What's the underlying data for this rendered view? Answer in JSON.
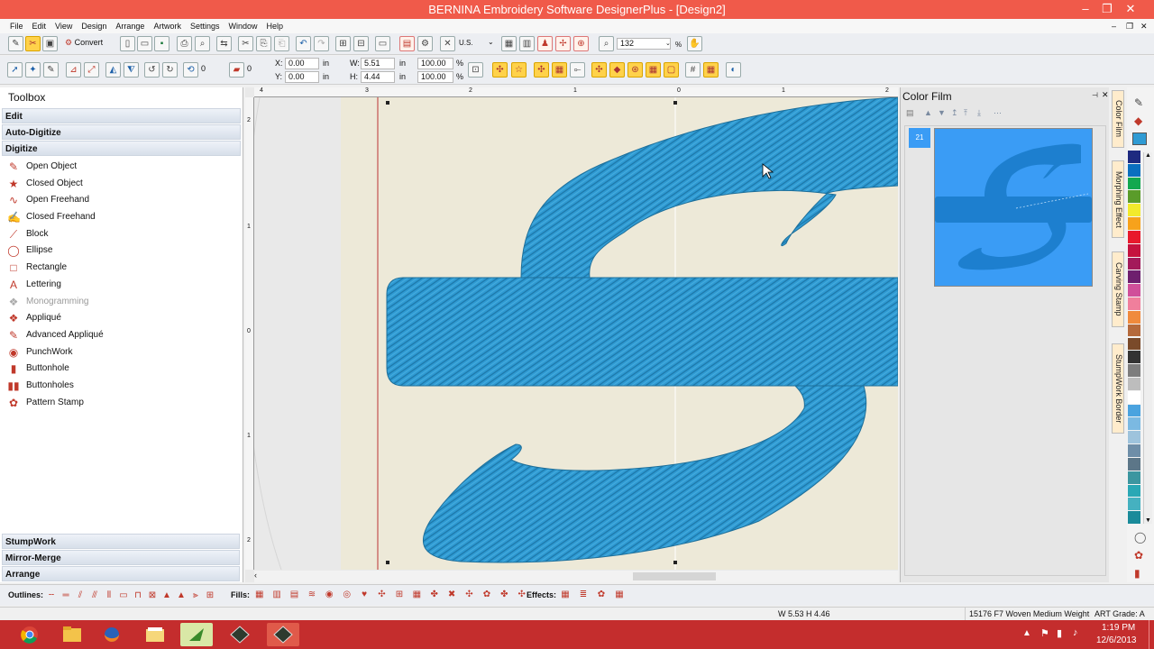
{
  "window": {
    "title": "BERNINA Embroidery Software DesignerPlus - [Design2]"
  },
  "menu": [
    "File",
    "Edit",
    "View",
    "Design",
    "Arrange",
    "Artwork",
    "Settings",
    "Window",
    "Help"
  ],
  "toolbar1": {
    "convert_label": "Convert",
    "units": "U.S.",
    "zoom_value": "132",
    "zoom_unit": "%"
  },
  "toolbar2": {
    "rotate_value": "0",
    "slant_value": "0",
    "x_label": "X:",
    "x_value": "0.00",
    "y_label": "Y:",
    "y_value": "0.00",
    "w_label": "W:",
    "w_value": "5.51",
    "h_label": "H:",
    "h_value": "4.44",
    "unit_in": "in",
    "sx_value": "100.00",
    "sy_value": "100.00",
    "pct": "%"
  },
  "toolbox": {
    "title": "Toolbox",
    "sections_top": [
      "Edit",
      "Auto-Digitize",
      "Digitize"
    ],
    "tools": [
      {
        "label": "Open Object",
        "icon": "open-object-icon",
        "glyph": "✎",
        "enabled": true
      },
      {
        "label": "Closed Object",
        "icon": "closed-object-icon",
        "glyph": "★",
        "enabled": true
      },
      {
        "label": "Open Freehand",
        "icon": "open-freehand-icon",
        "glyph": "∿",
        "enabled": true
      },
      {
        "label": "Closed Freehand",
        "icon": "closed-freehand-icon",
        "glyph": "✍",
        "enabled": true
      },
      {
        "label": "Block",
        "icon": "block-icon",
        "glyph": "⟋",
        "enabled": true
      },
      {
        "label": "Ellipse",
        "icon": "ellipse-icon",
        "glyph": "◯",
        "enabled": true
      },
      {
        "label": "Rectangle",
        "icon": "rectangle-icon",
        "glyph": "□",
        "enabled": true
      },
      {
        "label": "Lettering",
        "icon": "lettering-icon",
        "glyph": "A",
        "enabled": true
      },
      {
        "label": "Monogramming",
        "icon": "monogramming-icon",
        "glyph": "❖",
        "enabled": false
      },
      {
        "label": "Appliqué",
        "icon": "applique-icon",
        "glyph": "❖",
        "enabled": true
      },
      {
        "label": "Advanced Appliqué",
        "icon": "advanced-applique-icon",
        "glyph": "✎",
        "enabled": true
      },
      {
        "label": "PunchWork",
        "icon": "punchwork-icon",
        "glyph": "◉",
        "enabled": true
      },
      {
        "label": "Buttonhole",
        "icon": "buttonhole-icon",
        "glyph": "▮",
        "enabled": true
      },
      {
        "label": "Buttonholes",
        "icon": "buttonholes-icon",
        "glyph": "▮▮",
        "enabled": true
      },
      {
        "label": "Pattern Stamp",
        "icon": "pattern-stamp-icon",
        "glyph": "✿",
        "enabled": true
      }
    ],
    "sections_bottom": [
      "StumpWork",
      "Mirror-Merge",
      "Arrange"
    ]
  },
  "ruler": {
    "h_ticks": [
      "4",
      "3",
      "2",
      "1",
      "0",
      "1",
      "2"
    ],
    "v_ticks": [
      "2",
      "1",
      "0",
      "1",
      "2"
    ]
  },
  "color_film": {
    "title": "Color Film",
    "item_number": "21",
    "thread_color": "#2f9bd4",
    "film_bg": "#3a9cf5",
    "shape_color": "#1d7fcf"
  },
  "side_tabs": [
    "Color Film",
    "Morphing Effect",
    "Carving Stamp",
    "StumpWork Border"
  ],
  "palette_colors": [
    "#1e2a80",
    "#0b6fbf",
    "#13a84f",
    "#5a9c2a",
    "#f2ea2c",
    "#f7a21b",
    "#e8192c",
    "#c5123e",
    "#a31a5a",
    "#6e1f6e",
    "#d04f9a",
    "#f07f9c",
    "#f08a3c",
    "#b56a3c",
    "#7a4a2a",
    "#333333",
    "#7d7d7d",
    "#bdbdbd",
    "#ffffff",
    "#4aa3df",
    "#7bb9e2",
    "#9ec3dc",
    "#6e8ea8",
    "#5c7688",
    "#3c96a0",
    "#2aa8b5",
    "#45b1c0",
    "#1a8b9a"
  ],
  "bottombar": {
    "outlines_label": "Outlines:",
    "fills_label": "Fills:",
    "effects_label": "Effects:"
  },
  "status": {
    "dimensions": "W 5.53 H 4.46",
    "fabric": "15176 F7 Woven Medium Weight",
    "art_grade": "ART Grade: A"
  },
  "taskbar": {
    "time": "1:19 PM",
    "date": "12/6/2013",
    "apps": [
      "chrome-icon",
      "explorer-icon",
      "firefox-icon",
      "folder-icon",
      "bernina-icon",
      "artwork-icon",
      "designer-icon"
    ]
  },
  "colors": {
    "titlebar": "#f05a4a",
    "taskbar": "#c42d2d",
    "hoop": "#ede9d8",
    "accent_red": "#c0392b"
  }
}
